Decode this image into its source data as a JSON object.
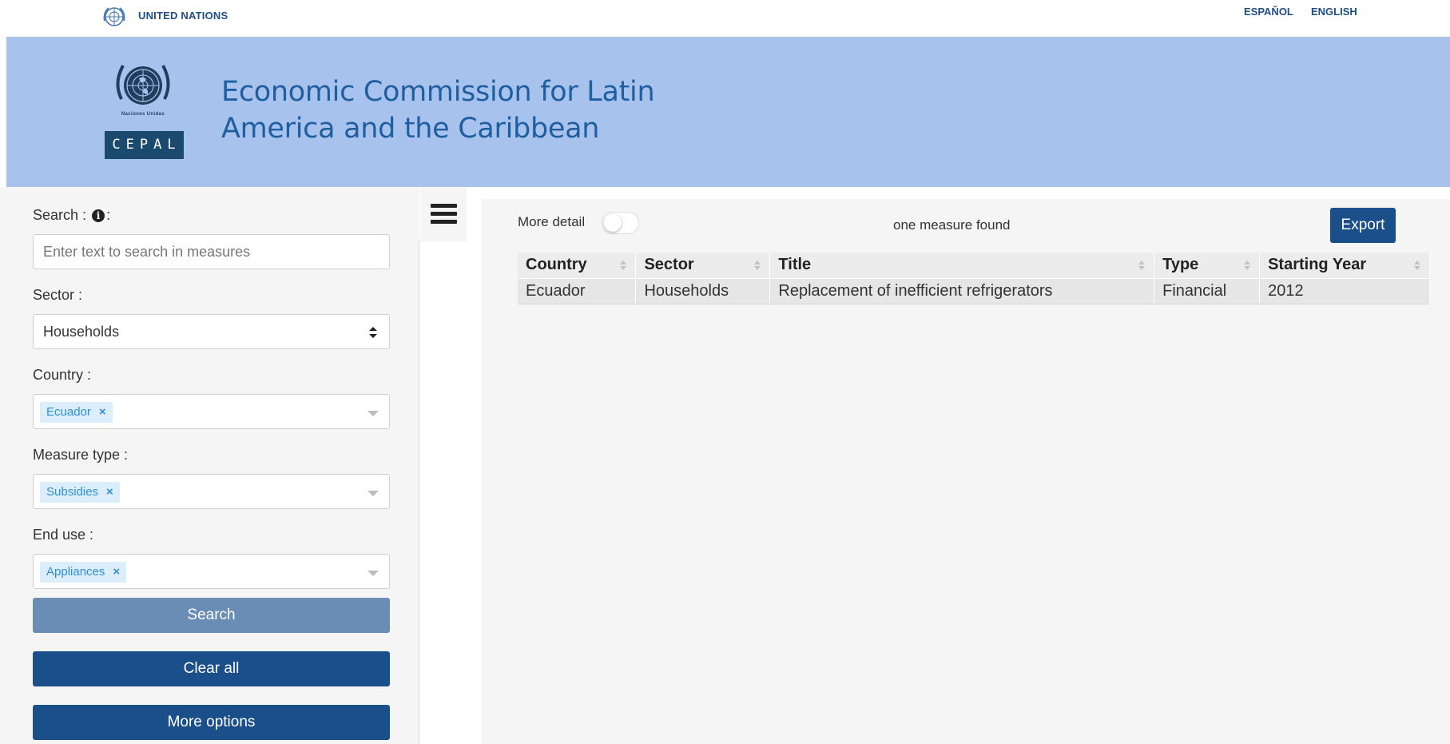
{
  "topbar": {
    "org_label": "UNITED NATIONS",
    "lang_es": "ESPAÑOL",
    "lang_en": "ENGLISH"
  },
  "banner": {
    "title": "Economic Commission for Latin America and the Caribbean",
    "emblem_caption": "Naciones Unidas",
    "logo_text": "CEPAL"
  },
  "sidebar": {
    "search_label_prefix": "Search :",
    "search_label_suffix": ":",
    "search_placeholder": "Enter text to search in measures",
    "sector_label": "Sector :",
    "sector_value": "Households",
    "country_label": "Country :",
    "country_tag": "Ecuador",
    "measure_type_label": "Measure type :",
    "measure_type_tag": "Subsidies",
    "end_use_label": "End use :",
    "end_use_tag": "Appliances",
    "tag_remove": "×",
    "search_button": "Search",
    "clear_button": "Clear all",
    "more_button": "More options"
  },
  "main": {
    "more_detail_label": "More detail",
    "more_detail_enabled": false,
    "result_count_text": "one measure found",
    "export_button": "Export",
    "columns": [
      "Country",
      "Sector",
      "Title",
      "Type",
      "Starting Year"
    ],
    "rows": [
      [
        "Ecuador",
        "Households",
        "Replacement of inefficient refrigerators",
        "Financial",
        "2012"
      ]
    ]
  },
  "colors": {
    "banner_bg": "#a8c2ee",
    "primary_button": "#1a4f8a",
    "search_button": "#6a8db5",
    "tag_bg": "#dceefb",
    "tag_text": "#2f8ed6"
  }
}
